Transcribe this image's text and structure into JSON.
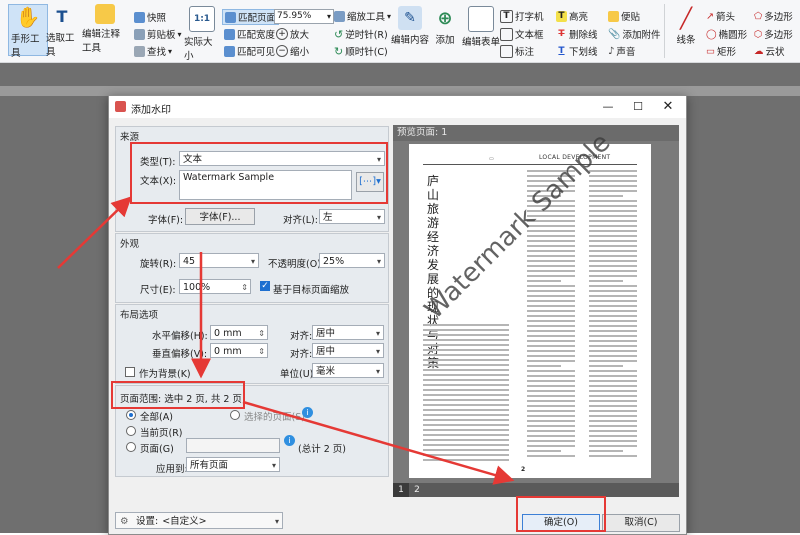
{
  "toolbar": {
    "hand_tool": "手形工具",
    "select_tool": "选取工具",
    "annotation_tool": "编辑注释工具",
    "snapshot": "快照",
    "clipboard": "剪贴板",
    "find": "查找",
    "actual_size": "实际大小",
    "fit_page": "匹配页面",
    "fit_width": "匹配宽度",
    "fit_visible": "匹配可见",
    "zoom_value": "75.95%",
    "zoom_in": "放大",
    "zoom_out": "缩小",
    "zoom_tool": "缩放工具",
    "rotate_ccw": "逆时针(R)",
    "rotate_cw": "顺时针(C)",
    "edit_content": "编辑内容",
    "add": "添加",
    "edit_form": "编辑表单",
    "typewriter": "打字机",
    "textbox": "文本框",
    "callout": "标注",
    "highlight": "高亮",
    "strikeout": "删除线",
    "underline": "下划线",
    "sticky_note": "便贴",
    "attach_file": "添加附件",
    "sound": "声音",
    "line": "线条",
    "arrow": "箭头",
    "ellipse": "椭圆形",
    "rectangle": "矩形",
    "polygon": "多边形",
    "polyline": "多边形",
    "cloud": "云状"
  },
  "dialog": {
    "title": "添加水印",
    "source_title": "来源",
    "type_label": "类型(T):",
    "type_value": "文本",
    "text_label": "文本(X):",
    "text_value": "Watermark Sample",
    "font_label": "字体(F):",
    "font_button": "字体(F)...",
    "align_label": "对齐(L):",
    "align_value": "左",
    "appearance_title": "外观",
    "rotate_label": "旋转(R):",
    "rotate_value": "45",
    "opacity_label": "不透明度(O):",
    "opacity_value": "25%",
    "size_label": "尺寸(E):",
    "size_value": "100%",
    "scale_check": "基于目标页面缩放",
    "layout_title": "布局选项",
    "hoffset_label": "水平偏移(H):",
    "hoffset_value": "0 mm",
    "halign_label": "对齐:",
    "halign_value": "居中",
    "voffset_label": "垂直偏移(V):",
    "voffset_value": "0 mm",
    "valign_label": "对齐:",
    "valign_value": "居中",
    "background_check": "作为背景(K)",
    "unit_label": "单位(U):",
    "unit_value": "毫米",
    "range_title": "页面范围: 选中 2 页, 共 2 页",
    "range_all": "全部(A)",
    "range_selected": "选择的页面(S)",
    "range_current": "当前页(R)",
    "range_pages": "页面(G)",
    "range_total": "(总计 2 页)",
    "apply_label": "应用到:",
    "apply_value": "所有页面",
    "preview_title": "预览页面: 1",
    "page_tabs": [
      "1",
      "2"
    ],
    "settings_label": "设置:",
    "settings_value": "<自定义>",
    "ok_button": "确定(O)",
    "cancel_button": "取消(C)"
  },
  "preview_page": {
    "header_text": "LOCAL DEVELOPMENT",
    "article_title": "庐山旅游经济发展的现状与对策",
    "watermark": "Watermark Sample",
    "footer_mark": "2"
  },
  "colors": {
    "highlight_box": "#e53935",
    "arrow": "#e53935",
    "accent_blue": "#1e6fd0"
  }
}
